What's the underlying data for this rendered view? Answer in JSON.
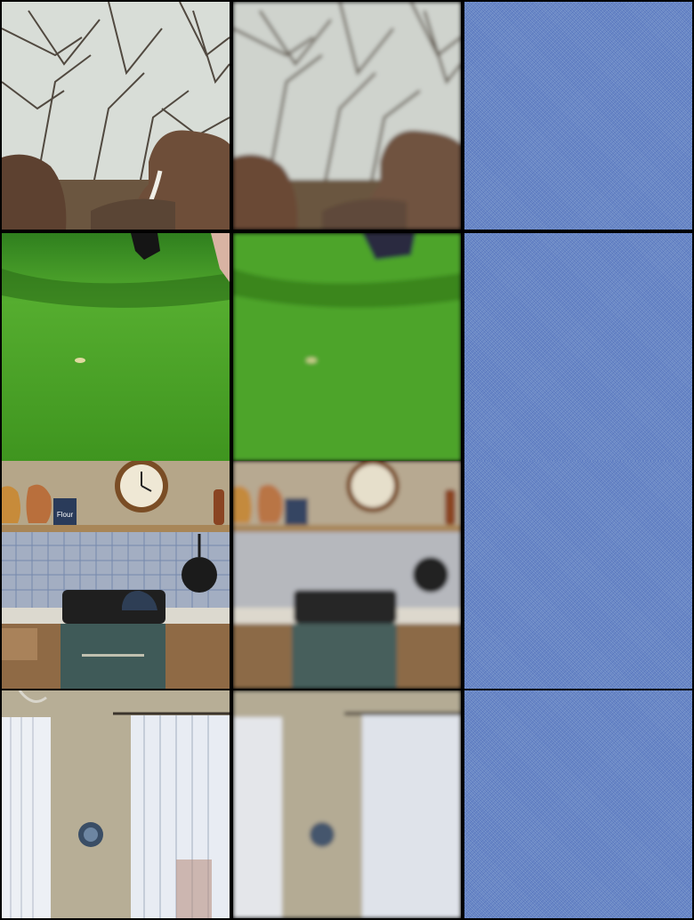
{
  "grid": {
    "rows": 4,
    "cols": 3,
    "columns": [
      "original",
      "blurred",
      "noise"
    ],
    "scenes": [
      "elephants-in-forest",
      "grass-field-with-player-feet",
      "kitchen-stove-wall",
      "room-with-curtains"
    ]
  },
  "colors": {
    "border": "#000000",
    "noise_base": "#6d8cc4",
    "sky": "#d5dcd8",
    "elephant": "#6a4a35",
    "grass": "#4aa32a",
    "kitchen_wall": "#b8a98c",
    "tile_blue": "#7e93b8",
    "stove": "#3f5a58",
    "room_wall": "#b7ad95",
    "curtain": "#e9ecf2"
  },
  "labels": {
    "flour_canister": "Flour"
  }
}
